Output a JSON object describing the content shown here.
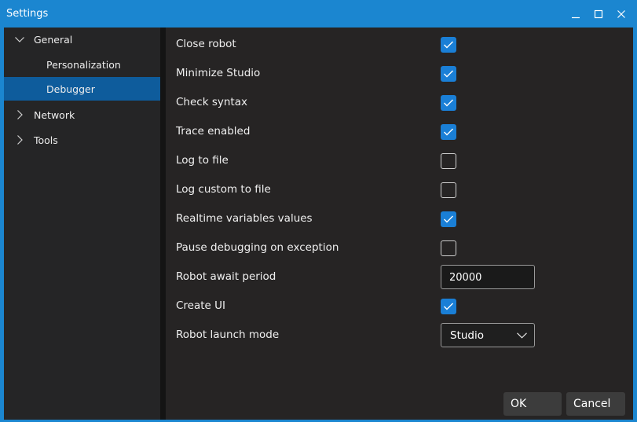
{
  "window": {
    "title": "Settings"
  },
  "sidebar": {
    "items": [
      {
        "label": "General",
        "expanded": true
      },
      {
        "label": "Personalization"
      },
      {
        "label": "Debugger",
        "selected": true
      },
      {
        "label": "Network",
        "expanded": false
      },
      {
        "label": "Tools",
        "expanded": false
      }
    ]
  },
  "settings": {
    "close_robot": {
      "label": "Close robot",
      "checked": true
    },
    "minimize_studio": {
      "label": "Minimize Studio",
      "checked": true
    },
    "check_syntax": {
      "label": "Check syntax",
      "checked": true
    },
    "trace_enabled": {
      "label": "Trace enabled",
      "checked": true
    },
    "log_to_file": {
      "label": "Log to file",
      "checked": false
    },
    "log_custom_to_file": {
      "label": "Log custom to file",
      "checked": false
    },
    "realtime_variables": {
      "label": "Realtime variables values",
      "checked": true
    },
    "pause_on_exception": {
      "label": "Pause debugging on exception",
      "checked": false
    },
    "await_period": {
      "label": "Robot await period",
      "value": "20000"
    },
    "create_ui": {
      "label": "Create UI",
      "checked": true
    },
    "launch_mode": {
      "label": "Robot launch mode",
      "selected": "Studio"
    }
  },
  "footer": {
    "ok_label": "OK",
    "cancel_label": "Cancel"
  },
  "colors": {
    "titlebar": "#1b86d0",
    "accent": "#1a7fd6",
    "selection": "#0e5c9c",
    "background": "#252526"
  }
}
